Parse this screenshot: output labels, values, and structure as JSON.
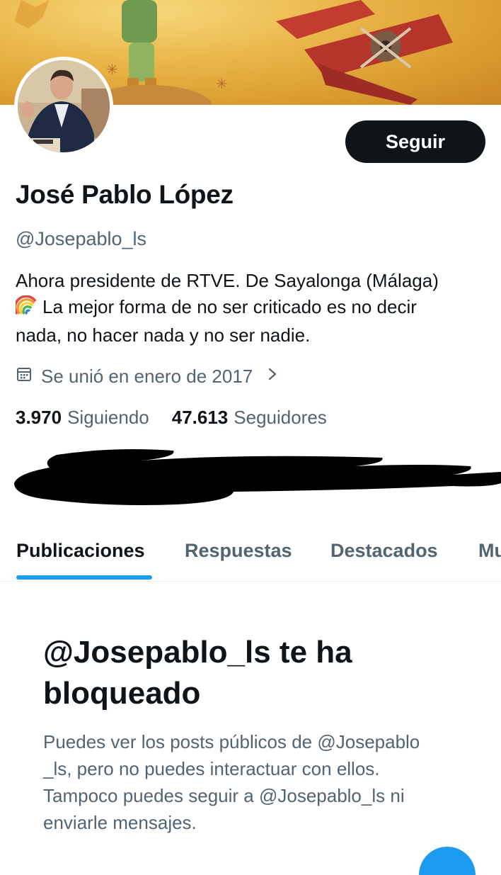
{
  "profile": {
    "name": "José Pablo López",
    "handle": "@Josepablo_ls",
    "bio_lines": [
      "Ahora presidente de RTVE. De Sayalonga (Málaga)",
      "La mejor forma de no ser criticado es no decir",
      "nada, no hacer nada y no ser nadie."
    ],
    "bio_emoji": "rainbow-emoji",
    "joined": "Se unió en enero de 2017",
    "following_count": "3.970",
    "following_label": "Siguiendo",
    "followers_count": "47.613",
    "followers_label": "Seguidores"
  },
  "actions": {
    "follow_label": "Seguir"
  },
  "tabs": [
    {
      "label": "Publicaciones",
      "active": true
    },
    {
      "label": "Respuestas",
      "active": false
    },
    {
      "label": "Destacados",
      "active": false
    },
    {
      "label": "Mu",
      "active": false
    }
  ],
  "blocked": {
    "title_lines": [
      "@Josepablo_ls te ha",
      "bloqueado"
    ],
    "text_lines": [
      "Puedes ver los posts públicos de @Josepablo",
      "_ls, pero no puedes interactuar con ellos.",
      "Tampoco puedes seguir a @Josepablo_ls ni",
      "enviarle mensajes."
    ]
  },
  "colors": {
    "accent": "#1d9bf0",
    "text_primary": "#0f1419",
    "text_secondary": "#536471",
    "follow_button_bg": "#0f1419"
  }
}
